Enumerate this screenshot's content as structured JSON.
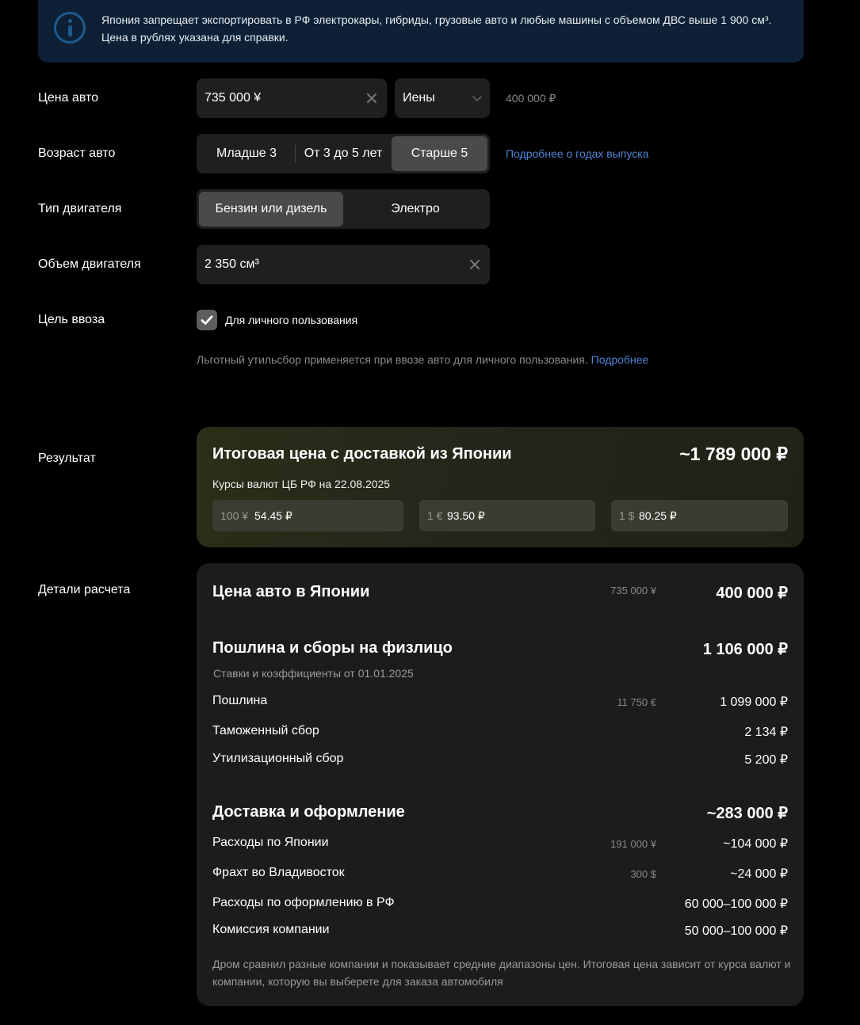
{
  "banner": {
    "line1": "Япония запрещает экспортировать в РФ электрокары, гибриды, грузовые авто и любые машины с объемом ДВС выше 1 900 см³.",
    "line2": "Цена в рублях указана для справки."
  },
  "price": {
    "label": "Цена авто",
    "value": "735 000 ¥",
    "currency": "Иены",
    "rub_hint": "400 000 ₽"
  },
  "age": {
    "label": "Возраст авто",
    "options": [
      "Младше 3",
      "От 3 до 5 лет",
      "Старше 5"
    ],
    "selected": "Старше 5",
    "link": "Подробнее о годах выпуска"
  },
  "engine": {
    "label": "Тип двигателя",
    "options": [
      "Бензин или дизель",
      "Электро"
    ],
    "selected": "Бензин или дизель"
  },
  "volume": {
    "label": "Объем двигателя",
    "value": "2 350 см³"
  },
  "purpose": {
    "label": "Цель ввоза",
    "checkbox_label": "Для личного пользования",
    "checked": true,
    "note": "Льготный утильсбор применяется при ввозе авто для личного пользования.",
    "note_link": "Подробнее"
  },
  "result": {
    "label": "Результат",
    "title": "Итоговая цена с доставкой из Японии",
    "total": "~1 789 000 ₽",
    "rates_title": "Курсы валют ЦБ РФ на 22.08.2025",
    "rates": [
      {
        "unit": "100 ¥",
        "value": "54.45 ₽"
      },
      {
        "unit": "1 €",
        "value": "93.50 ₽"
      },
      {
        "unit": "1 $",
        "value": "80.25 ₽"
      }
    ]
  },
  "details": {
    "label": "Детали расчета",
    "car": {
      "title": "Цена авто в Японии",
      "orig": "735 000 ¥",
      "value": "400 000 ₽"
    },
    "duty": {
      "title": "Пошлина и сборы на физлицо",
      "value": "1 106 000 ₽",
      "sub": "Ставки и коэффициенты от 01.01.2025",
      "rows": [
        {
          "label": "Пошлина",
          "orig": "11 750 €",
          "value": "1 099 000 ₽"
        },
        {
          "label": "Таможенный сбор",
          "orig": "",
          "value": "2 134 ₽"
        },
        {
          "label": "Утилизационный сбор",
          "orig": "",
          "value": "5 200 ₽"
        }
      ]
    },
    "delivery": {
      "title": "Доставка и оформление",
      "value": "~283 000 ₽",
      "rows": [
        {
          "label": "Расходы по Японии",
          "orig": "191 000 ¥",
          "value": "~104 000 ₽"
        },
        {
          "label": "Фрахт во Владивосток",
          "orig": "300 $",
          "value": "~24 000 ₽"
        },
        {
          "label": "Расходы по оформлению в РФ",
          "orig": "",
          "value": "60 000–100 000 ₽"
        },
        {
          "label": "Комиссия компании",
          "orig": "",
          "value": "50 000–100 000 ₽"
        }
      ]
    },
    "footnote": "Дром сравнил разные компании и показывает средние диапазоны цен. Итоговая цена зависит от курса валют и компании, которую вы выберете для заказа автомобиля"
  },
  "colors": {
    "background": "#000000",
    "surface": "#1f1f1f",
    "banner": "#0d2035",
    "link": "#4f86d6",
    "result_card": "#2c2e19"
  }
}
